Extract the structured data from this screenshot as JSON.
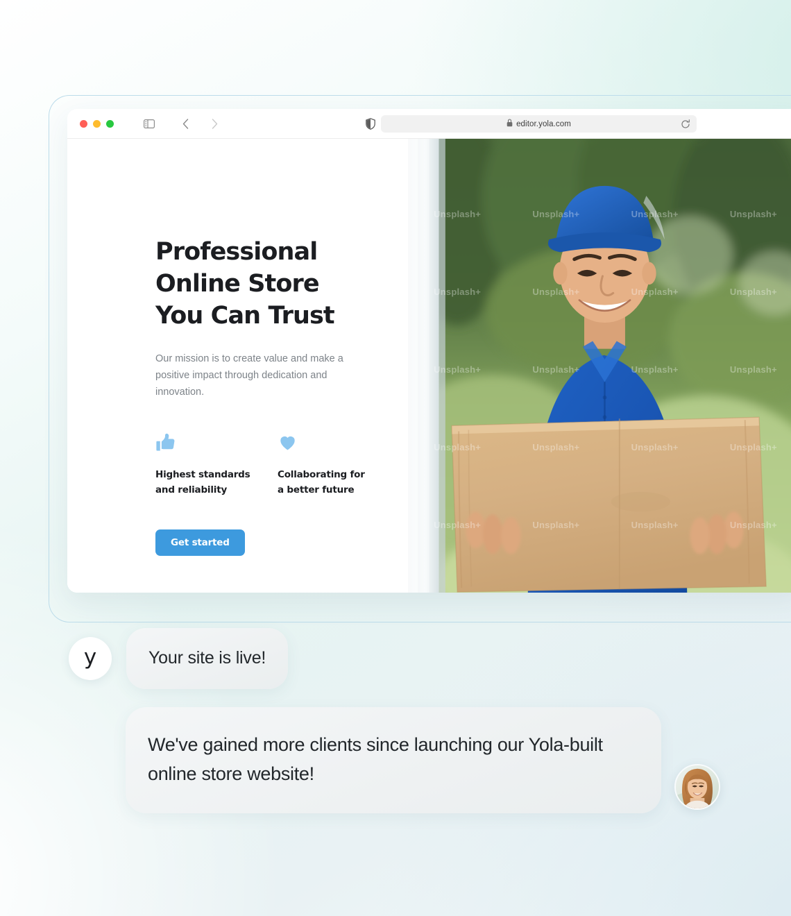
{
  "browser": {
    "traffic_lights": [
      "close",
      "minimize",
      "maximize"
    ],
    "sidebar_icon": "sidebar-toggle-icon",
    "back_icon": "chevron-left-icon",
    "forward_icon": "chevron-right-icon",
    "shield_icon": "shield-privacy-icon",
    "lock_icon": "lock-icon",
    "url": "editor.yola.com",
    "reload_icon": "reload-icon"
  },
  "site": {
    "hero": {
      "title": "Professional Online Store You Can Trust",
      "subtitle": "Our mission is to create value and make a positive impact through dedication and innovation.",
      "cta_label": "Get started",
      "cta_color": "#3d9ade",
      "icon_color": "#8cc6ef",
      "features": [
        {
          "icon": "thumbs-up-icon",
          "label": "Highest standards and reliability"
        },
        {
          "icon": "heart-icon",
          "label": "Collaborating for a better future"
        }
      ]
    },
    "photo": {
      "alt": "delivery-person-holding-box",
      "watermark": "Unsplash+"
    }
  },
  "chat": {
    "brand_avatar_letter": "y",
    "messages": [
      {
        "from": "brand",
        "text": "Your site is live!"
      },
      {
        "from": "customer",
        "text": "We've gained more clients since launching our Yola-built online store website!"
      }
    ],
    "customer_avatar": "customer-photo-avatar"
  }
}
